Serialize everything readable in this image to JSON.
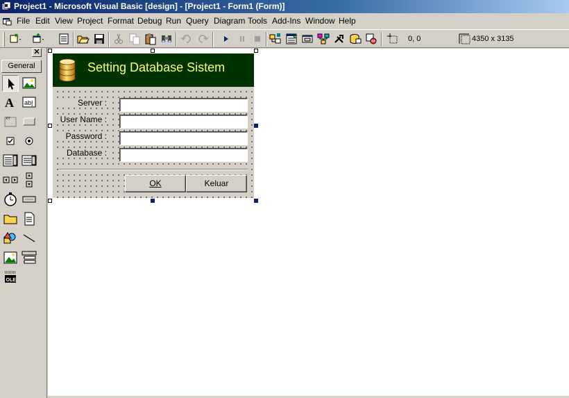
{
  "window": {
    "title": "Project1 - Microsoft Visual Basic [design] - [Project1 - Form1 (Form)]"
  },
  "menu": {
    "items": [
      "File",
      "Edit",
      "View",
      "Project",
      "Format",
      "Debug",
      "Run",
      "Query",
      "Diagram",
      "Tools",
      "Add-Ins",
      "Window",
      "Help"
    ]
  },
  "toolbar": {
    "position_readout": "0, 0",
    "size_readout": "4350 x 3135",
    "icons": [
      "add-project-icon",
      "add-form-icon",
      "menu-editor-icon",
      "open-icon",
      "save-icon",
      "cut-icon",
      "copy-icon",
      "paste-icon",
      "find-icon",
      "undo-icon",
      "redo-icon",
      "start-icon",
      "break-icon",
      "end-icon",
      "project-explorer-icon",
      "properties-window-icon",
      "form-layout-icon",
      "object-browser-icon",
      "toolbox-icon",
      "data-view-icon",
      "component-manager-icon"
    ]
  },
  "toolbox": {
    "close_label": "✕",
    "tab_label": "General",
    "tools": [
      "pointer",
      "picturebox",
      "label",
      "textbox",
      "frame",
      "commandbutton",
      "checkbox",
      "optionbutton",
      "combobox",
      "listbox",
      "hscrollbar",
      "vscrollbar",
      "timer",
      "drivelistbox",
      "dirlistbox",
      "filelistbox",
      "shape",
      "line",
      "image",
      "data",
      "ole"
    ]
  },
  "form": {
    "title": "Setting Database Sistem",
    "fields": [
      {
        "label": "Server :",
        "value": ""
      },
      {
        "label": "User Name :",
        "value": ""
      },
      {
        "label": "Password :",
        "value": ""
      },
      {
        "label": "Database :",
        "value": ""
      }
    ],
    "ok_label": "OK",
    "keluar_label": "Keluar"
  },
  "colors": {
    "form_header_bg": "#003300",
    "form_title": "#ffff66",
    "titlebar_start": "#0a246a"
  }
}
